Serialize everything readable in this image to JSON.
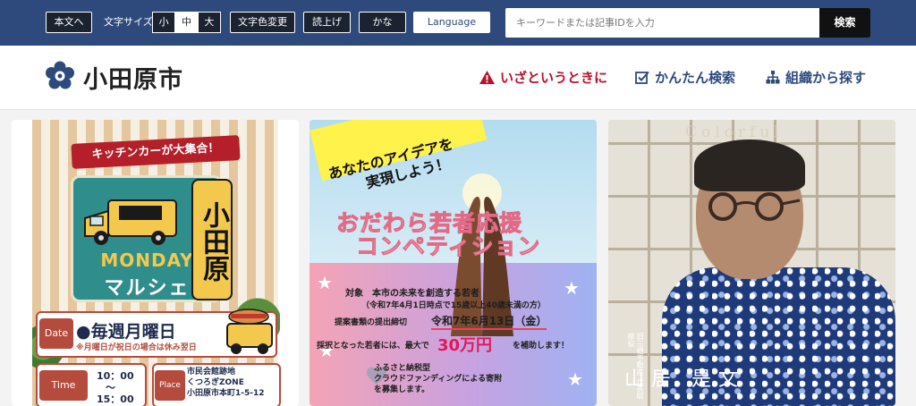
{
  "topbar": {
    "skip_to_content": "本文へ",
    "font_size_label": "文字サイズ",
    "font_size_options": [
      "小",
      "中",
      "大"
    ],
    "font_size_selected": "中",
    "color_change": "文字色変更",
    "read_aloud": "読上げ",
    "kana": "かな",
    "language": "Language",
    "search_placeholder": "キーワードまたは記事IDを入力",
    "search_button": "検索"
  },
  "header": {
    "site_name": "小田原市",
    "nav": {
      "emergency": "いざというときに",
      "easy_search": "かんたん検索",
      "org_search": "組織から探す"
    }
  },
  "slides": [
    {
      "banner": "キッチンカーが大集合！",
      "brand": "MONDAY",
      "brand_sub": "マルシェ",
      "city": "小田原",
      "date_label": "Date",
      "date_main": "●毎週月曜日",
      "date_note": "※月曜日が祝日の場合は休み翌日",
      "time_label": "Time",
      "time_start": "10：00",
      "time_sep": "〜",
      "time_end": "15：00",
      "place_label": "Place",
      "place_line1": "市民会館跡地",
      "place_line2": "くつろぎZONE",
      "place_line3": "小田原市本町1-5-12"
    },
    {
      "ribbon_line1": "あなたのアイデアを",
      "ribbon_line2": "実現しよう！",
      "title_line1": "おだわら若者応援",
      "title_line2": "コンペティション",
      "target": "対象　本市の未来を創造する若者",
      "target_note": "（令和7年4月1日時点で15歳以上40歳未満の方）",
      "deadline_label": "提案書類の提出締切",
      "deadline": "令和7年6月13日（金）",
      "subsidy_prefix": "採択となった若者には、最大で",
      "subsidy_amount": "30万円",
      "subsidy_suffix": "を補助します！",
      "crowd_line1": "ふるさと納税型",
      "crowd_line2": "クラウドファンディングによる寄附",
      "crowd_line3": "を募集します。"
    },
    {
      "series": "Colorful",
      "caption": "旧三栖不動産 代表取締役",
      "name": "山居 是文"
    }
  ],
  "colors": {
    "topbar_bg": "#2e4a7d",
    "emergency": "#b8122b",
    "nav_blue": "#2e4a7d"
  }
}
